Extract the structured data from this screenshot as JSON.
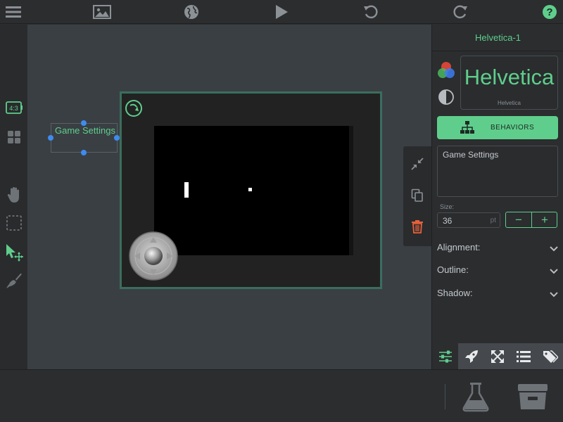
{
  "toolbar": {
    "icons": [
      "menu-icon",
      "image-icon",
      "globe-icon",
      "play-icon",
      "undo-icon",
      "redo-icon",
      "help-icon"
    ],
    "help_glyph": "?"
  },
  "left_tools": {
    "aspect_label": "4:3",
    "icons": [
      "aspect-ratio-icon",
      "grid-icon",
      "hand-icon",
      "marquee-select-icon",
      "pointer-move-icon",
      "brush-icon"
    ]
  },
  "canvas": {
    "label_object_text": "Game Settings"
  },
  "inspector": {
    "title": "Helvetica-1",
    "font_preview_large": "Helvetica",
    "font_preview_small": "Helvetica",
    "behaviors_label": "BEHAVIORS",
    "text_value": "Game Settings",
    "size_label": "Size:",
    "size_value": "36",
    "size_unit": "pt",
    "minus": "−",
    "plus": "+",
    "sections": [
      "Alignment:",
      "Outline:",
      "Shadow:"
    ],
    "tabs": [
      "sliders-icon",
      "rocket-icon",
      "expand-arrows-icon",
      "list-icon",
      "tags-icon"
    ]
  },
  "bottom": {
    "icons": [
      "flask-icon",
      "drawer-icon"
    ]
  },
  "colors": {
    "accent": "#5fce8c",
    "handle": "#3d8cf0",
    "delete": "#e8613a"
  }
}
